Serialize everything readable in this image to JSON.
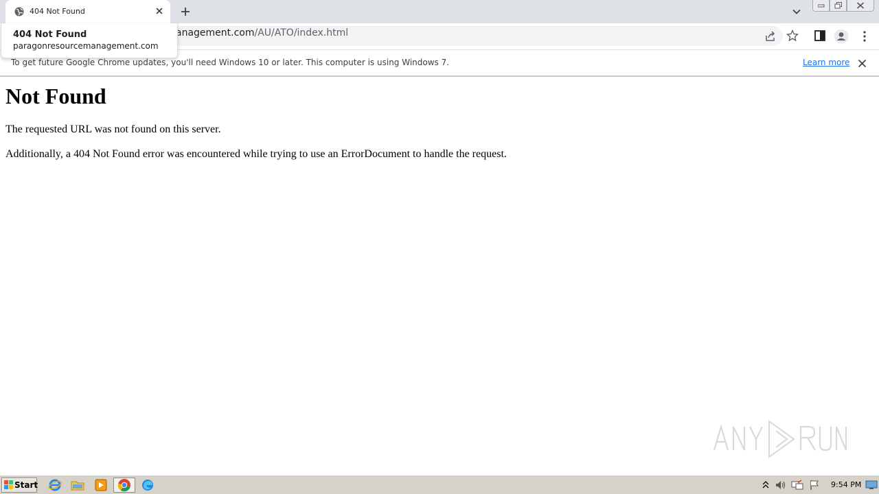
{
  "tab": {
    "title": "404 Not Found"
  },
  "hover_card": {
    "title": "404 Not Found",
    "domain": "paragonresourcemanagement.com"
  },
  "omnibox": {
    "visible_url_host": "anagement.com",
    "visible_url_path": "/AU/ATO/index.html"
  },
  "infobar": {
    "message": "To get future Google Chrome updates, you'll need Windows 10 or later. This computer is using Windows 7.",
    "link": "Learn more"
  },
  "page": {
    "heading": "Not Found",
    "paragraph1": "The requested URL was not found on this server.",
    "paragraph2": "Additionally, a 404 Not Found error was encountered while trying to use an ErrorDocument to handle the request."
  },
  "watermark": {
    "text": "ANY RUN"
  },
  "taskbar": {
    "start_label": "Start",
    "apps": [
      "internet-explorer-icon",
      "file-explorer-icon",
      "media-player-icon",
      "chrome-icon",
      "edge-icon"
    ],
    "clock": "9:54 PM"
  },
  "colors": {
    "tabstrip": "#dee1e6",
    "link": "#1a73e8",
    "taskbar": "#d6d2c9"
  }
}
